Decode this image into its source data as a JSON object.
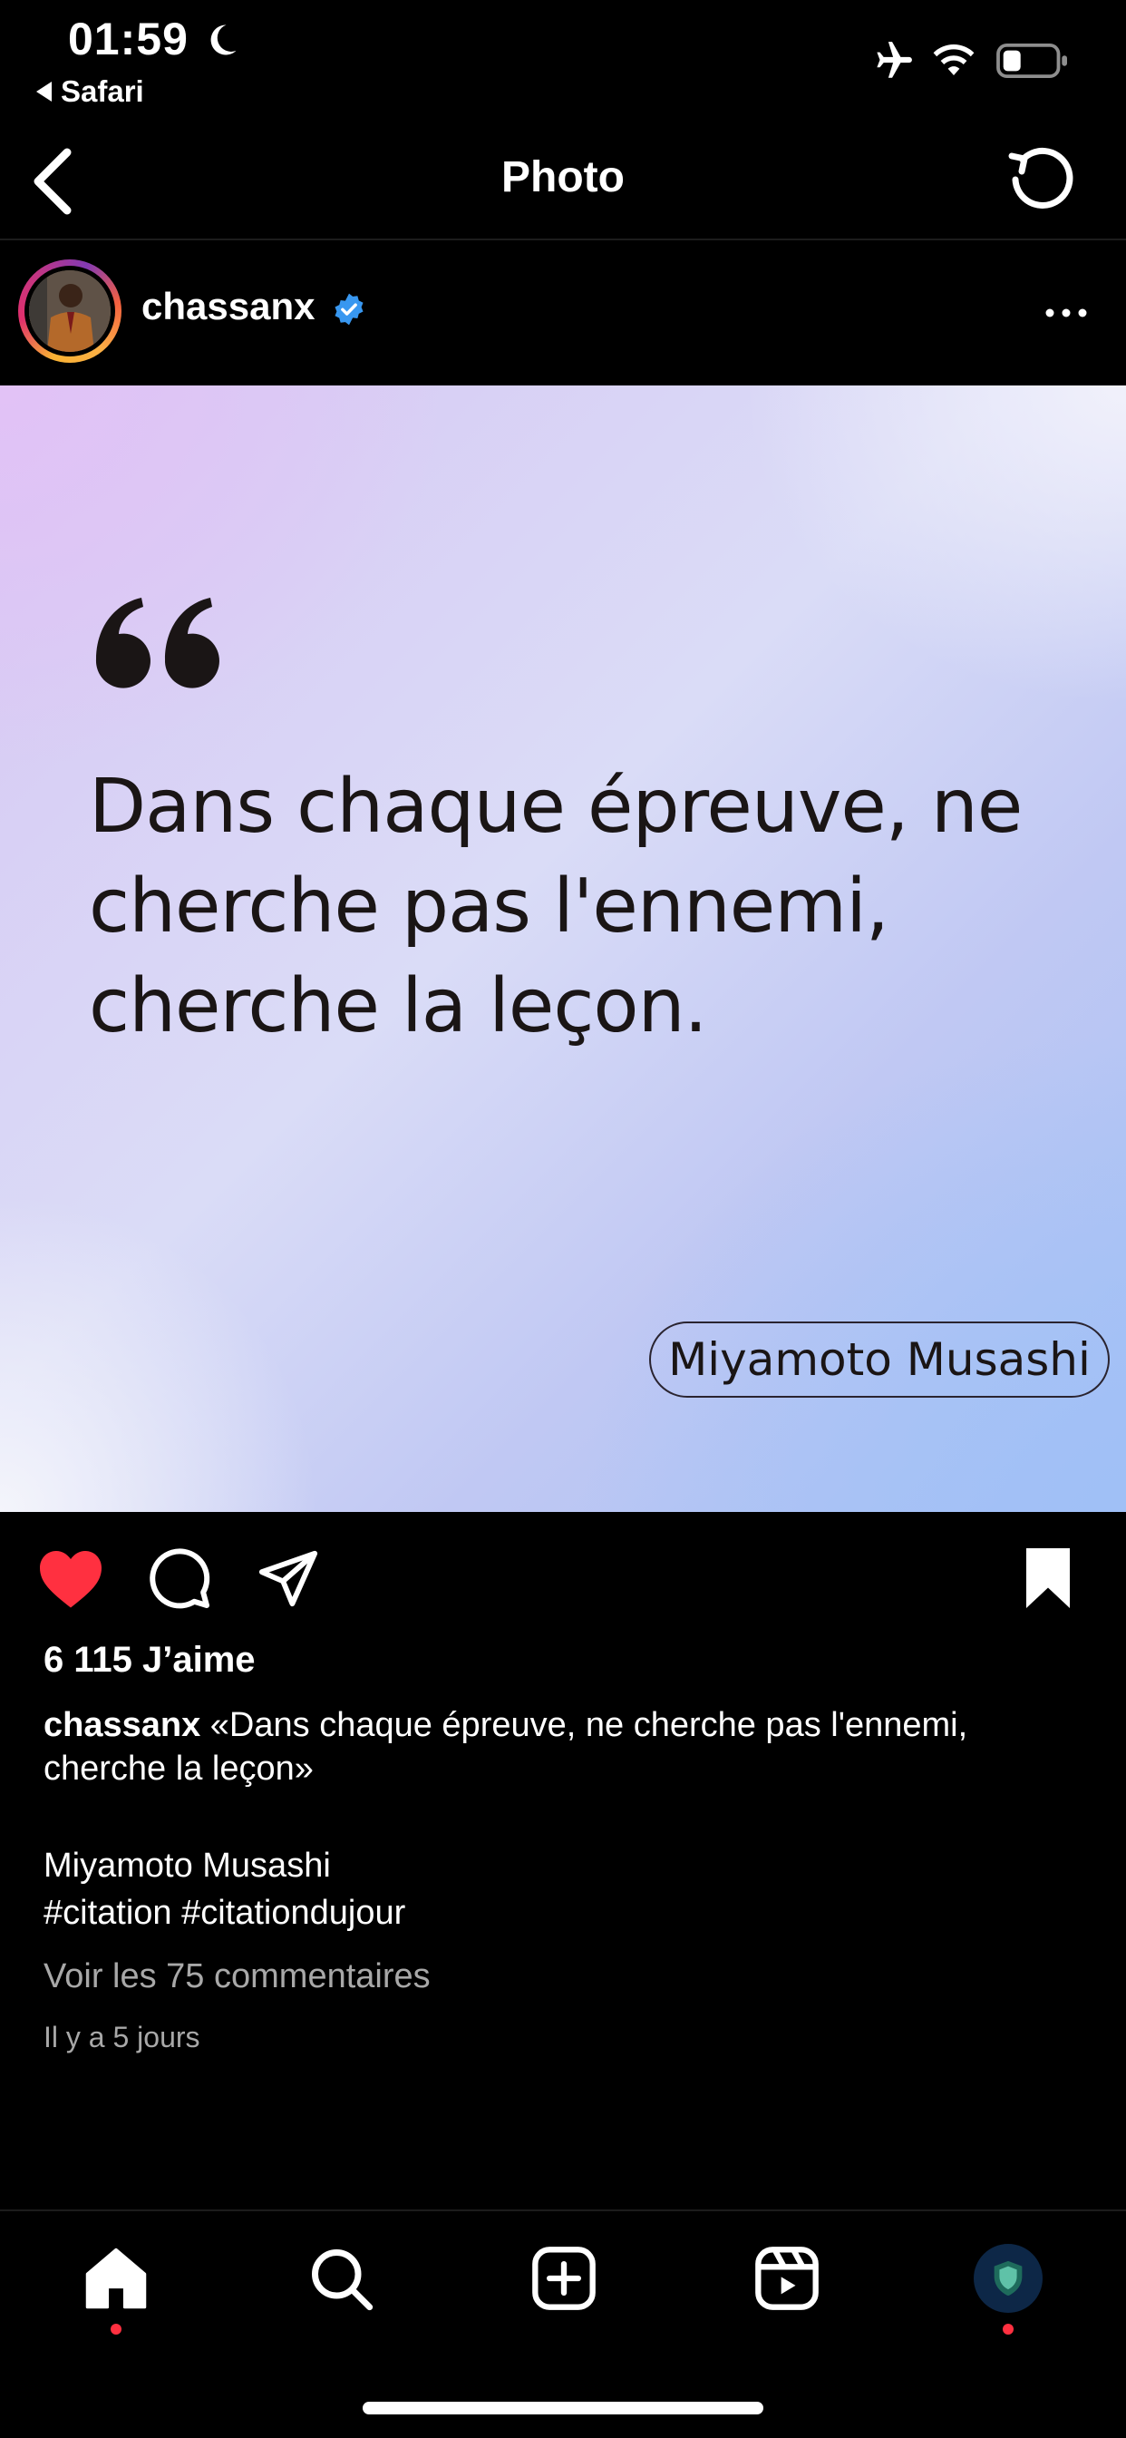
{
  "status_bar": {
    "time": "01:59",
    "back_app": "Safari",
    "icons": [
      "moon-icon",
      "airplane-icon",
      "wifi-icon",
      "battery-icon"
    ]
  },
  "header": {
    "title": "Photo",
    "icons": [
      "chevron-left-icon",
      "refresh-icon"
    ]
  },
  "post": {
    "username": "chassanx",
    "verified": true,
    "image": {
      "quote": "Dans chaque épreuve, ne cherche pas l'ennemi, cherche la leçon.",
      "author": "Miyamoto Musashi"
    },
    "liked": true,
    "likes": "6 115 J’aime",
    "caption_text": "«Dans chaque épreuve, ne cherche pas l'ennemi, cherche la leçon»",
    "caption_author": "Miyamoto Musashi",
    "hashtags": "#citation #citationdujour",
    "view_comments": "Voir les 75 commentaires",
    "timestamp": "Il y a 5 jours"
  },
  "bottom_nav": {
    "items": [
      "home-icon",
      "search-icon",
      "create-icon",
      "reels-icon",
      "profile-avatar"
    ]
  },
  "colors": {
    "background": "#000000",
    "like": "#ff3040",
    "verified": "#3897f0",
    "secondary_text": "#a8a8a8"
  }
}
